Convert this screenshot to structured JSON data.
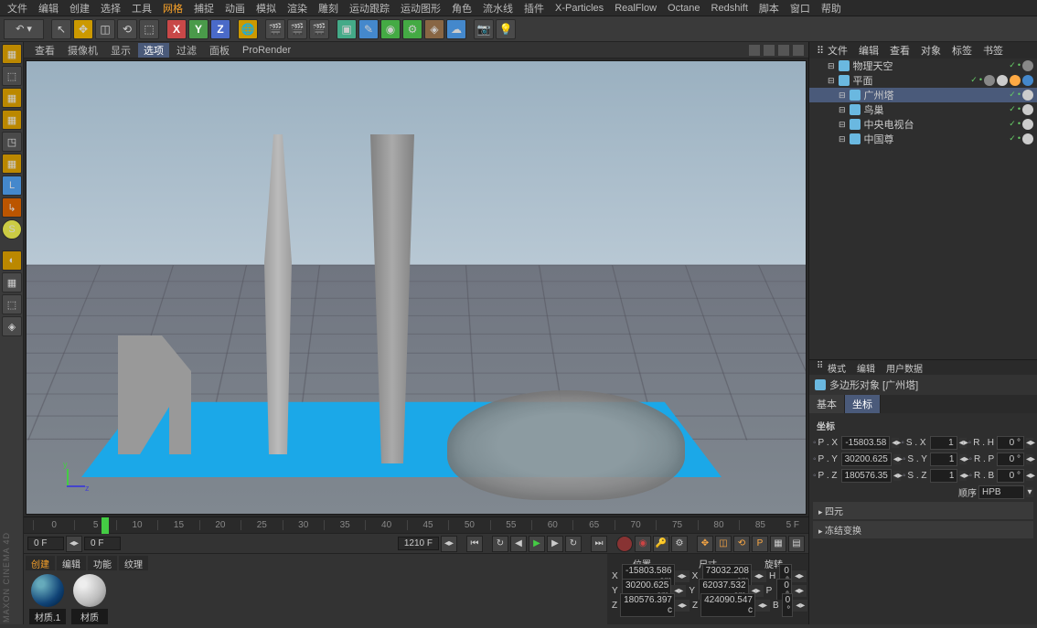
{
  "menu": {
    "items": [
      "文件",
      "编辑",
      "创建",
      "选择",
      "工具",
      "网格",
      "捕捉",
      "动画",
      "模拟",
      "渲染",
      "雕刻",
      "运动跟踪",
      "运动图形",
      "角色",
      "流水线",
      "插件",
      "X-Particles",
      "RealFlow",
      "Octane",
      "Redshift",
      "脚本",
      "窗口",
      "帮助"
    ],
    "highlight": 5
  },
  "viewport_menu": {
    "items": [
      "查看",
      "摄像机",
      "显示",
      "选项",
      "过滤",
      "面板",
      "ProRender"
    ],
    "selected": 3
  },
  "timeline": {
    "ticks": [
      "0",
      "5",
      "10",
      "15",
      "20",
      "25",
      "30",
      "35",
      "40",
      "45",
      "50",
      "55",
      "60",
      "65",
      "70",
      "75",
      "80",
      "85"
    ],
    "end_label": "5 F"
  },
  "transport": {
    "f_start": "0 F",
    "f_cur": "0 F",
    "f_total": "1210 F"
  },
  "materials": {
    "tabs": [
      "创建",
      "编辑",
      "功能",
      "纹理"
    ],
    "items": [
      {
        "name": "材质.1",
        "color": "radial-gradient(circle at 30% 30%, #6ab 10%, #147 60%, #024 90%)"
      },
      {
        "name": "材质",
        "color": "radial-gradient(circle at 30% 30%, #eee 10%, #bbb 60%, #888 90%)"
      }
    ]
  },
  "coord": {
    "headers": [
      "位置",
      "尺寸",
      "旋转"
    ],
    "rows": [
      {
        "axis": "X",
        "pos": "-15803.586 cm",
        "size": "73032.208 cm",
        "rot_lbl": "H",
        "rot": "0 °"
      },
      {
        "axis": "Y",
        "pos": "30200.625 cm",
        "size": "62037.532 cm",
        "rot_lbl": "P",
        "rot": "0 °"
      },
      {
        "axis": "Z",
        "pos": "180576.397 c",
        "size": "424090.547 c",
        "rot_lbl": "B",
        "rot": "0 °"
      }
    ]
  },
  "right_tabs": {
    "items": [
      "文件",
      "编辑",
      "查看",
      "对象",
      "标签",
      "书签"
    ]
  },
  "objects": [
    {
      "name": "物理天空",
      "icon": "#6ab8e0",
      "sel": false,
      "indent": 0,
      "tags": [
        "#888"
      ]
    },
    {
      "name": "平面",
      "icon": "#6ab8e0",
      "sel": false,
      "indent": 0,
      "tags": [
        "#888",
        "#ccc",
        "#fa4",
        "#48c"
      ]
    },
    {
      "name": "广州塔",
      "icon": "#6ab8e0",
      "sel": true,
      "indent": 1,
      "tags": [
        "#ccc"
      ]
    },
    {
      "name": "鸟巢",
      "icon": "#6ab8e0",
      "sel": false,
      "indent": 1,
      "tags": [
        "#ccc"
      ]
    },
    {
      "name": "中央电视台",
      "icon": "#6ab8e0",
      "sel": false,
      "indent": 1,
      "tags": [
        "#ccc"
      ]
    },
    {
      "name": "中国尊",
      "icon": "#6ab8e0",
      "sel": false,
      "indent": 1,
      "tags": [
        "#ccc"
      ]
    }
  ],
  "attr": {
    "tabs": [
      "模式",
      "编辑",
      "用户数据"
    ],
    "title": "多边形对象 [广州塔]",
    "mode_tabs": [
      "基本",
      "坐标"
    ],
    "mode_sel": 1,
    "section_label": "坐标",
    "rows": [
      {
        "l1": "P . X",
        "v1": "-15803.58",
        "l2": "S . X",
        "v2": "1",
        "l3": "R . H",
        "v3": "0 °"
      },
      {
        "l1": "P . Y",
        "v1": "30200.625",
        "l2": "S . Y",
        "v2": "1",
        "l3": "R . P",
        "v3": "0 °"
      },
      {
        "l1": "P . Z",
        "v1": "180576.35",
        "l2": "S . Z",
        "v2": "1",
        "l3": "R . B",
        "v3": "0 °"
      }
    ],
    "order_label": "顺序",
    "order_value": "HPB",
    "collapse": [
      "四元",
      "冻结变换"
    ]
  },
  "brand": "MAXON CINEMA 4D"
}
